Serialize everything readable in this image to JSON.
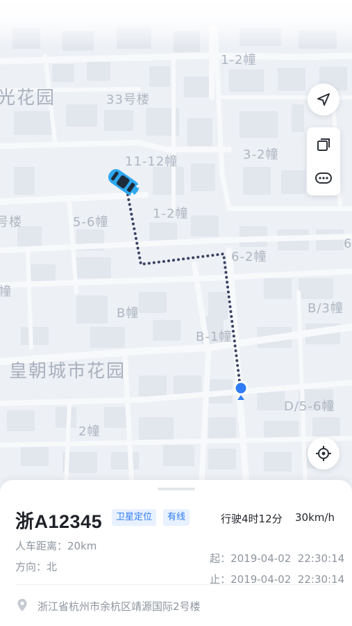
{
  "map": {
    "labels": [
      {
        "text": "1-2幢",
        "kind": "normal"
      },
      {
        "text": "光花园",
        "kind": "big"
      },
      {
        "text": "33号楼",
        "kind": "normal"
      },
      {
        "text": "3-2幢",
        "kind": "normal"
      },
      {
        "text": "11-12幢",
        "kind": "normal"
      },
      {
        "text": "号楼",
        "kind": "normal"
      },
      {
        "text": "5-6幢",
        "kind": "normal"
      },
      {
        "text": "1-2幢",
        "kind": "normal"
      },
      {
        "text": "6-2幢",
        "kind": "normal"
      },
      {
        "text": "6",
        "kind": "normal"
      },
      {
        "text": "幢",
        "kind": "normal"
      },
      {
        "text": "B幢",
        "kind": "normal"
      },
      {
        "text": "B/3幢",
        "kind": "normal"
      },
      {
        "text": "B-1幢",
        "kind": "normal"
      },
      {
        "text": "皇朝城市花园",
        "kind": "big"
      },
      {
        "text": "D/5-6幢",
        "kind": "normal"
      },
      {
        "text": "2幢",
        "kind": "normal"
      }
    ],
    "route_color": "#3b4363",
    "car_color": "#2fa8f0",
    "position_color": "#2f7cf6",
    "controls": {
      "locate_icon": "navigation-arrow-icon",
      "layers_icon": "layers-icon",
      "more_icon": "more-dots-icon",
      "recenter_icon": "crosshair-icon"
    }
  },
  "vehicle": {
    "plate": "浙A12345",
    "tags": [
      "卫星定位",
      "有线"
    ],
    "drive_time": "行驶4时12分",
    "speed": "30km/h",
    "distance_label": "人车距离：",
    "distance_value": "20km",
    "direction_label": "方向：",
    "direction_value": "北",
    "start_label": "起：",
    "start_time": "2019-04-02  22:30:14",
    "end_label": "止：",
    "end_time": "2019-04-02  22:30:14",
    "address": "浙江省杭州市余杭区靖源国际2号楼",
    "address_icon": "location-pin-icon"
  }
}
